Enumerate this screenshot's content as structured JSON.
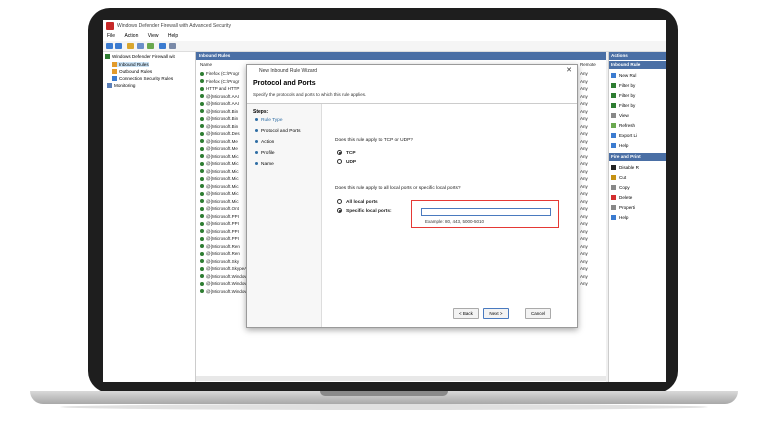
{
  "app": {
    "title": "Windows Defender Firewall with Advanced Security"
  },
  "menu": [
    "File",
    "Action",
    "View",
    "Help"
  ],
  "tree": [
    "Windows Defender Firewall wit",
    "Inbound Rules",
    "Outbound Rules",
    "Connection Security Rules",
    "Monitoring"
  ],
  "list": {
    "header": "Inbound Rules",
    "col_name": "Name",
    "col_remote": "Remote",
    "rows": [
      "Firefox (C:\\Progr",
      "Firefox (C:\\Progr",
      "HTTP and HTTP",
      "@{Microsoft.AAI",
      "@{Microsoft.AAI",
      "@{Microsoft.Bin",
      "@{Microsoft.Bin",
      "@{Microsoft.Bin",
      "@{Microsoft.Des",
      "@{Microsoft.Me",
      "@{Microsoft.Me",
      "@{Microsoft.Mic",
      "@{Microsoft.Mic",
      "@{Microsoft.Mic",
      "@{Microsoft.Mic",
      "@{Microsoft.Mic",
      "@{Microsoft.Mic",
      "@{Microsoft.Mic",
      "@{Microsoft.Ont",
      "@{Microsoft.PPI",
      "@{Microsoft.PPI",
      "@{Microsoft.PPI",
      "@{Microsoft.PPI",
      "@{Microsoft.Ren",
      "@{Microsoft.Ren",
      "@{Microsoft.Sky",
      "@{Microsoft.SkypeApp_12.1807.264.0_x6...   @{Microsoft.SkypeApp_12.1...   Domai...   Yes   Allow   No   Any   Any",
      "@{Microsoft.Windows.CloudExperience...   @{Microsoft.Windows.Clou...   Domai...   Yes   Allow   No   Any   Any",
      "@{Microsoft.Windows.CloudExperience...   @{Microsoft.Windows.Clou...   Domai...   Yes   Allow   No   Any   Any",
      "@{Microsoft.Windows.Cortana_1.7.0.143...   @{Microsoft.Windows.Cort...   All   Yes   Allow   No   Any   Any"
    ],
    "remote_values": [
      "Any",
      "Any",
      "Any",
      "Any",
      "Any",
      "Any",
      "Any",
      "Any",
      "Any",
      "Any",
      "Any",
      "Any",
      "Any",
      "Any",
      "Any",
      "Any",
      "Any",
      "Any",
      "Any",
      "Any",
      "Any",
      "Any",
      "Any",
      "Any",
      "Any",
      "Any",
      "Any",
      "Any",
      "Any"
    ]
  },
  "actions": {
    "section1": "Inbound Rule",
    "items1": [
      "New Rul",
      "Filter by",
      "Filter by",
      "Filter by",
      "View",
      "Refresh",
      "Export Li",
      "Help"
    ],
    "section2": "Fire and Print",
    "items2": [
      "Disable R",
      "Cut",
      "Copy",
      "Delete",
      "Properti",
      "Help"
    ]
  },
  "wizard": {
    "title": "New Inbound Rule Wizard",
    "close": "✕",
    "heading": "Protocol and Ports",
    "subheading": "Specify the protocols and ports to which this rule applies.",
    "steps_title": "Steps:",
    "steps": [
      "Rule Type",
      "Protocol and Ports",
      "Action",
      "Profile",
      "Name"
    ],
    "q1": "Does this rule apply to TCP or UDP?",
    "opt_tcp": "TCP",
    "opt_udp": "UDP",
    "q2": "Does this rule apply to all local ports or specific local ports?",
    "opt_all_ports": "All local ports",
    "opt_specific_ports": "Specific local ports:",
    "ports_value": "",
    "example": "Example: 80, 443, 5000-5010",
    "btn_back": "< Back",
    "btn_next": "Next >",
    "btn_cancel": "Cancel"
  },
  "colors": {
    "accent": "#4a6fa5",
    "highlight": "#e53935"
  }
}
